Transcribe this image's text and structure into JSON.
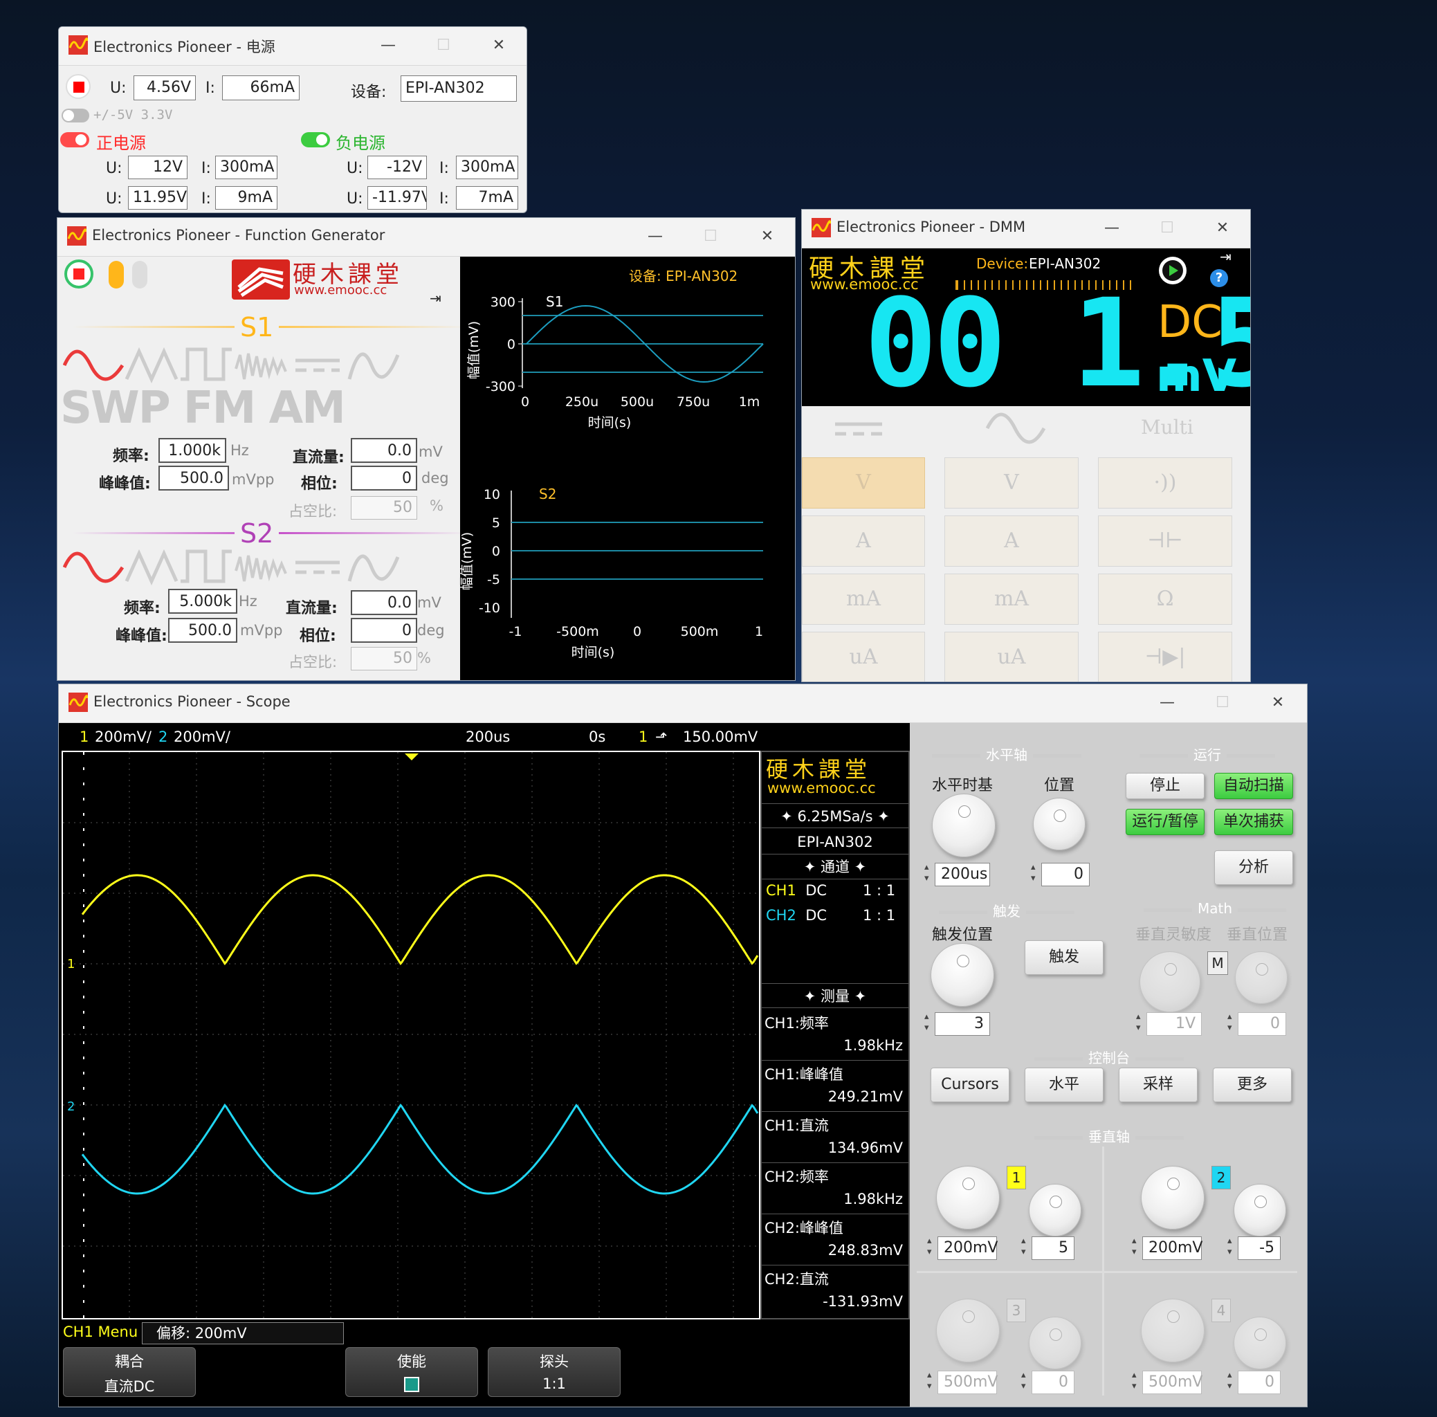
{
  "colors": {
    "ch1": "#ffff1a",
    "ch2": "#20d6f2",
    "dmm_digits": "#17e6f2",
    "dmm_unit": "#ffb61a",
    "green": "#3ccc40",
    "red": "#ff2a2a"
  },
  "power": {
    "title": "Electronics Pioneer - 电源",
    "u_label": "U:",
    "u_value": "4.56V",
    "i_label": "I:",
    "i_value": "66mA",
    "device_label": "设备:",
    "device_value": "EPI-AN302",
    "toggle_pm": "+/-5V 3.3V",
    "pos_label": "正电源",
    "neg_label": "负电源",
    "pos": {
      "u_set": "12V",
      "i_set": "300mA",
      "u_meas": "11.95V",
      "i_meas": "9mA"
    },
    "neg": {
      "u_set": "-12V",
      "i_set": "300mA",
      "u_meas": "-11.97V",
      "i_meas": "7mA"
    }
  },
  "fg": {
    "title": "Electronics Pioneer - Function Generator",
    "brand_cn": "硬木課堂",
    "brand_url": "www.emooc.cc",
    "s1_label": "S1",
    "s2_label": "S2",
    "modes": [
      "SWP",
      "FM",
      "AM"
    ],
    "freq_label": "频率:",
    "pp_label": "峰峰值:",
    "dc_label": "直流量:",
    "phase_label": "相位:",
    "duty_label": "占空比:",
    "unit_hz": "Hz",
    "unit_mvpp": "mVpp",
    "unit_mv": "mV",
    "unit_deg": "deg",
    "unit_pct": "%",
    "s1": {
      "freq": "1.000k",
      "pp": "500.0",
      "dc": "0.0",
      "phase": "0",
      "duty": "50"
    },
    "s2": {
      "freq": "5.000k",
      "pp": "500.0",
      "dc": "0.0",
      "phase": "0",
      "duty": "50"
    },
    "plot_device": "设备: EPI-AN302",
    "y_label": "幅值(mV)",
    "x_label": "时间(s)",
    "plot1": {
      "name": "S1",
      "yticks": [
        "300",
        "0",
        "-300"
      ],
      "xticks": [
        "0",
        "250u",
        "500u",
        "750u",
        "1m"
      ]
    },
    "plot2": {
      "name": "S2",
      "yticks": [
        "10",
        "5",
        "0",
        "-5",
        "-10"
      ],
      "xticks": [
        "-1",
        "-500m",
        "0",
        "500m",
        "1"
      ]
    }
  },
  "dmm": {
    "title": "Electronics Pioneer - DMM",
    "brand_cn": "硬木課堂",
    "brand_url": "www.emooc.cc",
    "device_label": "Device:",
    "device_value": "EPI-AN302",
    "reading": "00 1.5",
    "coupling": "DC",
    "unit": "mV",
    "col_multi": "Multi",
    "keys": [
      [
        "V",
        "V",
        "·))"
      ],
      [
        "A",
        "A",
        "⊣⊢"
      ],
      [
        "mA",
        "mA",
        "Ω"
      ],
      [
        "uA",
        "uA",
        "⊣▶|"
      ]
    ]
  },
  "scope": {
    "title": "Electronics Pioneer - Scope",
    "top": {
      "ch1_n": "1",
      "ch1_scale": "200mV/",
      "ch2_n": "2",
      "ch2_scale": "200mV/",
      "timebase": "200us",
      "offset": "0s",
      "trig_ch": "1",
      "trig_level": "150.00mV"
    },
    "brand_cn": "硬木課堂",
    "brand_url": "www.emooc.cc",
    "sample_rate": "6.25MSa/s",
    "device": "EPI-AN302",
    "channels_header": "通道",
    "channels": [
      {
        "name": "CH1",
        "coupling": "DC",
        "probe": "1 : 1"
      },
      {
        "name": "CH2",
        "coupling": "DC",
        "probe": "1 : 1"
      }
    ],
    "measure_header": "测量",
    "measurements": [
      {
        "label": "CH1:频率",
        "value": "1.98kHz"
      },
      {
        "label": "CH1:峰峰值",
        "value": "249.21mV"
      },
      {
        "label": "CH1:直流",
        "value": "134.96mV"
      },
      {
        "label": "CH2:频率",
        "value": "1.98kHz"
      },
      {
        "label": "CH2:峰峰值",
        "value": "248.83mV"
      },
      {
        "label": "CH2:直流",
        "value": "-131.93mV"
      }
    ],
    "menu": {
      "title": "CH1 Menu",
      "offset": "偏移: 200mV",
      "coupling_label": "耦合",
      "coupling_value": "直流DC",
      "enable_label": "使能",
      "probe_label": "探头",
      "probe_value": "1:1"
    },
    "marker_ch1": "1",
    "marker_ch2": "2",
    "panel": {
      "horizontal": "水平轴",
      "run": "运行",
      "timebase_label": "水平时基",
      "position_label": "位置",
      "timebase_value": "200us",
      "position_value": "0",
      "stop": "停止",
      "auto_scan": "自动扫描",
      "run_pause": "运行/暂停",
      "single": "单次捕获",
      "analyze": "分析",
      "trigger": "触发",
      "math": "Math",
      "trigger_pos_label": "触发位置",
      "trigger_pos_value": "3",
      "trigger_btn": "触发",
      "vsens_label": "垂直灵敏度",
      "vpos_label": "垂直位置",
      "math_m": "M",
      "math_sens": "1V",
      "math_pos": "0",
      "console": "控制台",
      "cursors": "Cursors",
      "level": "水平",
      "sample": "采样",
      "more": "更多",
      "vertical": "垂直轴",
      "ch": [
        {
          "n": "1",
          "scale": "200mV",
          "pos": "5"
        },
        {
          "n": "2",
          "scale": "200mV",
          "pos": "-5"
        },
        {
          "n": "3",
          "scale": "500mV",
          "pos": "0"
        },
        {
          "n": "4",
          "scale": "500mV",
          "pos": "0"
        }
      ]
    }
  },
  "waves": {
    "ch1": {
      "type": "full-wave rectified sine",
      "freq_khz": 1.98,
      "peak_mv": -250,
      "trough_mv": 0
    },
    "ch2": {
      "type": "inverted full-wave rectified sine",
      "freq_khz": 1.98,
      "peak_mv": 0,
      "trough_mv": -250
    }
  }
}
